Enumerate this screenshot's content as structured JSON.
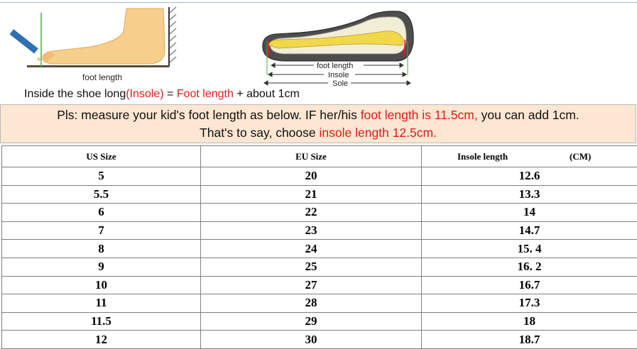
{
  "illustration": {
    "foot_label": "foot length",
    "shoe_labels": [
      "foot length",
      "Insole",
      "Sole"
    ],
    "formula": {
      "part1": "Inside the shoe long",
      "part2": "(Insole)",
      "part3": " = ",
      "part4": "Foot length",
      "part5": " + about 1cm"
    }
  },
  "banner": {
    "line1_a": "Pls: measure your kid's foot length as below. IF her/his ",
    "line1_b": "foot length is 11.5cm,",
    "line1_c": " you can add 1cm.",
    "line2_a": "That's to say, choose ",
    "line2_b": "insole length 12.5cm."
  },
  "table": {
    "headers": {
      "us": "US Size",
      "eu": "EU Size",
      "insole": "Insole length",
      "unit": "(CM)"
    },
    "rows": [
      {
        "us": "5",
        "eu": "20",
        "insole": "12.6"
      },
      {
        "us": "5.5",
        "eu": "21",
        "insole": "13.3"
      },
      {
        "us": "6",
        "eu": "22",
        "insole": "14"
      },
      {
        "us": "7",
        "eu": "23",
        "insole": "14.7"
      },
      {
        "us": "8",
        "eu": "24",
        "insole": "15. 4"
      },
      {
        "us": "9",
        "eu": "25",
        "insole": "16. 2"
      },
      {
        "us": "10",
        "eu": "27",
        "insole": "16.7"
      },
      {
        "us": "11",
        "eu": "28",
        "insole": "17.3"
      },
      {
        "us": "11.5",
        "eu": "29",
        "insole": "18"
      },
      {
        "us": "12",
        "eu": "30",
        "insole": "18.7"
      }
    ]
  },
  "colors": {
    "highlight": "#e01b1b",
    "banner_bg": "#fde6d2",
    "foot_skin": "#f7cf8c"
  }
}
